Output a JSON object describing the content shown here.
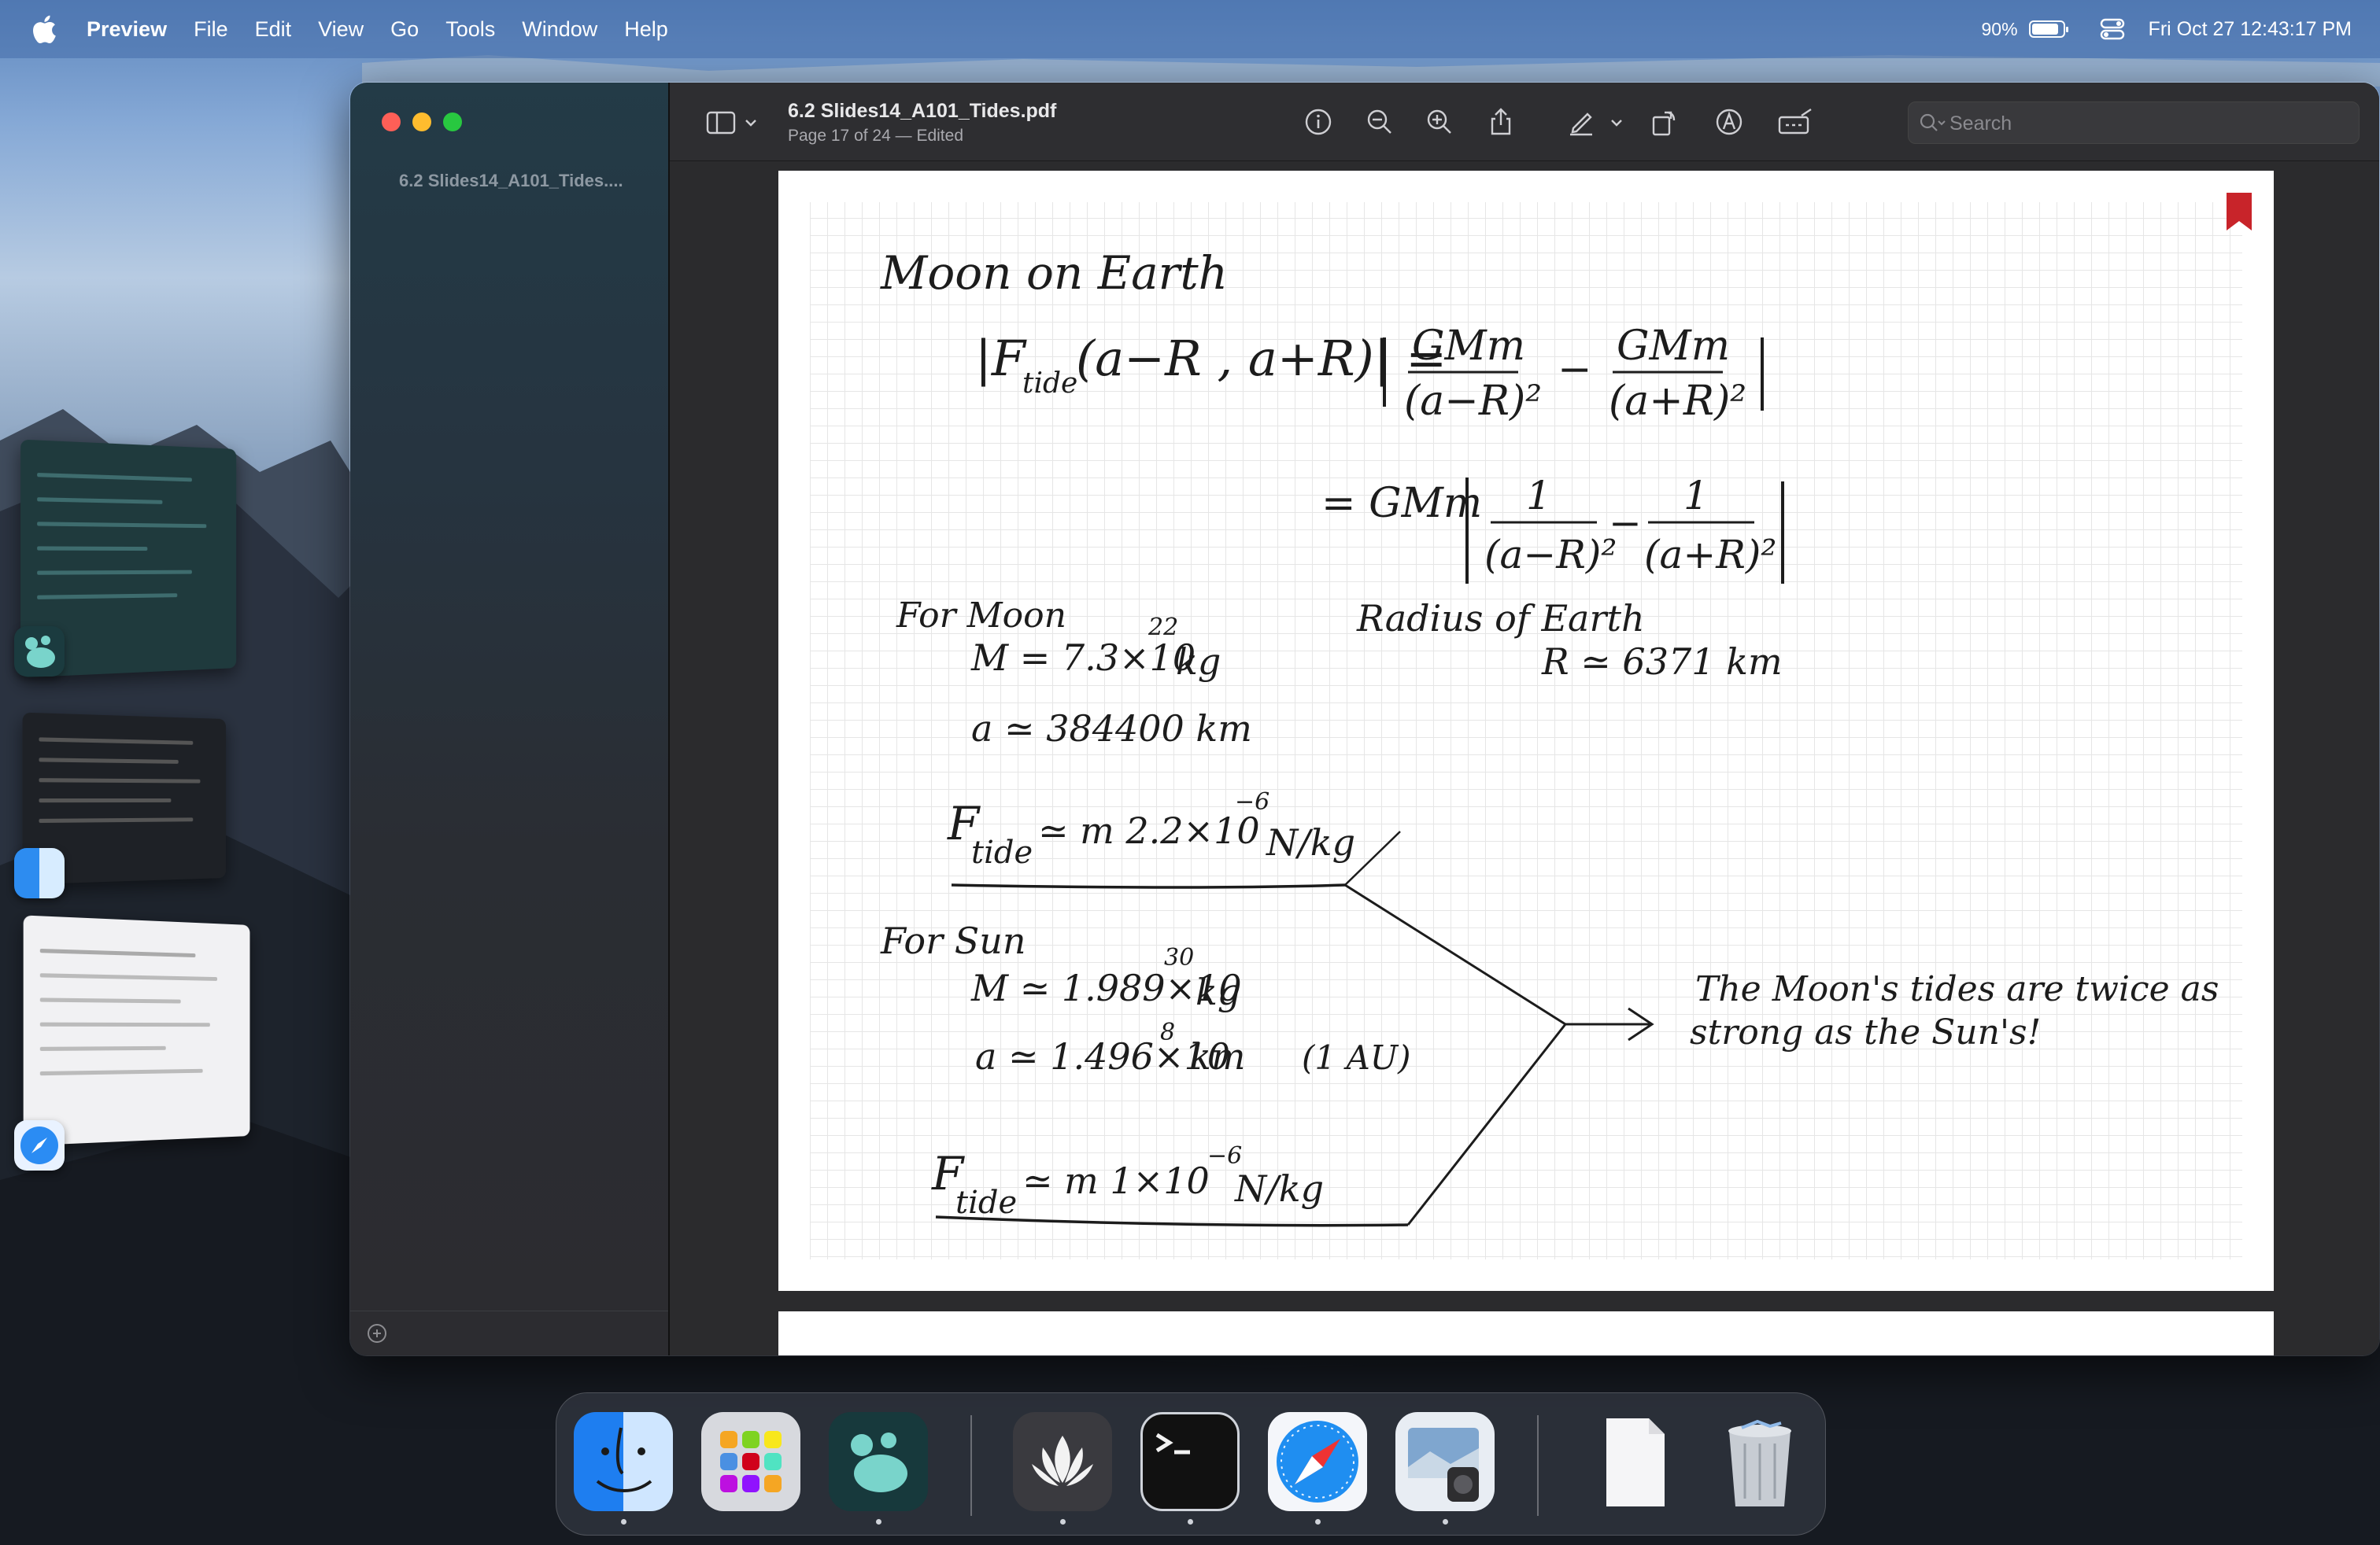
{
  "menubar": {
    "app_name": "Preview",
    "items": [
      "File",
      "Edit",
      "View",
      "Go",
      "Tools",
      "Window",
      "Help"
    ],
    "battery_percent": "90%",
    "battery_level": 0.9,
    "datetime": "Fri Oct 27  12:43:17 PM"
  },
  "window": {
    "sidebar": {
      "thumbnail_label": "6.2 Slides14_A101_Tides...."
    },
    "toolbar": {
      "title": "6.2 Slides14_A101_Tides.pdf",
      "subtitle": "Page 17 of 24 — Edited",
      "search_placeholder": "Search",
      "icons": [
        "sidebar-toggle-icon",
        "chevron-down-icon",
        "info-icon",
        "zoom-out-icon",
        "zoom-in-icon",
        "share-icon",
        "markup-pen-icon",
        "chevron-down-icon",
        "rotate-icon",
        "annotate-icon",
        "redact-icon",
        "search-icon"
      ]
    },
    "document": {
      "heading": "Moon on Earth",
      "eq1_lhs": "|F",
      "eq1_sub": "tide",
      "eq1_args": "(a−R , a+R)| =",
      "eq1_t1_num": "GMm",
      "eq1_t1_den": "(a−R)²",
      "eq1_minus": "−",
      "eq1_t2_num": "GMm",
      "eq1_t2_den": "(a+R)²",
      "eq2_prefix": "= GMm",
      "eq2_t1_num": "1",
      "eq2_t1_den": "(a−R)²",
      "eq2_minus": "−",
      "eq2_t2_num": "1",
      "eq2_t2_den": "(a+R)²",
      "moon_label": "For Moon",
      "moon_mass": "M = 7.3×10",
      "moon_mass_exp": "22",
      "moon_mass_unit": "kg",
      "moon_dist": "a ≃ 384400 km",
      "earth_label": "Radius of Earth",
      "earth_radius": "R ≃ 6371 km",
      "moon_ftide": "F",
      "moon_ftide_sub": "tide",
      "moon_ftide_val": "≃ m 2.2×10",
      "moon_ftide_exp": "−6",
      "moon_ftide_unit": "N/kg",
      "sun_label": "For Sun",
      "sun_mass": "M ≃ 1.989×10",
      "sun_mass_exp": "30",
      "sun_mass_unit": "kg",
      "sun_dist": "a ≃ 1.496×10",
      "sun_dist_exp": "8",
      "sun_dist_unit": "km",
      "sun_dist_note": "(1 AU)",
      "sun_ftide": "F",
      "sun_ftide_sub": "tide",
      "sun_ftide_val": "≃ m 1×10",
      "sun_ftide_exp": "−6",
      "sun_ftide_unit": "N/kg",
      "conclusion_line1": "The Moon's tides are twice as",
      "conclusion_line2": "strong as the Sun's!"
    }
  },
  "dock": {
    "apps": [
      "Finder",
      "Launchpad",
      "Mastodon",
      "Lotus",
      "Terminal",
      "Safari",
      "Preview",
      "Document",
      "Trash"
    ]
  },
  "colors": {
    "bookmark": "#c8242a",
    "traffic_red": "#fe5f57",
    "traffic_yellow": "#febc2e",
    "traffic_green": "#28c840"
  }
}
